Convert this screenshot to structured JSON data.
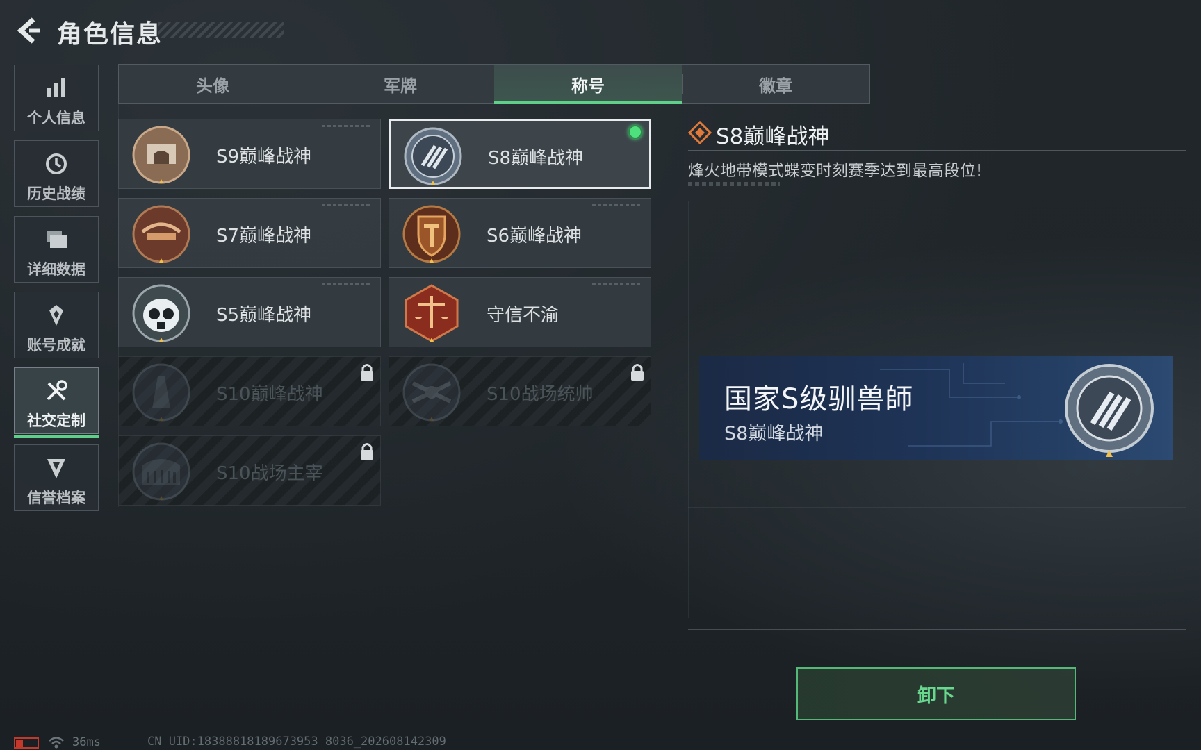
{
  "header": {
    "title": "角色信息"
  },
  "sidebar": {
    "items": [
      {
        "label": "个人信息",
        "icon": "bar-chart-icon",
        "active": false
      },
      {
        "label": "历史战绩",
        "icon": "history-clock-icon",
        "active": false
      },
      {
        "label": "详细数据",
        "icon": "folder-icon",
        "active": false
      },
      {
        "label": "账号成就",
        "icon": "achievement-icon",
        "active": false
      },
      {
        "label": "社交定制",
        "icon": "tools-icon",
        "active": true
      },
      {
        "label": "信誉档案",
        "icon": "reputation-icon",
        "active": false
      }
    ]
  },
  "tabs": [
    {
      "label": "头像",
      "active": false
    },
    {
      "label": "军牌",
      "active": false
    },
    {
      "label": "称号",
      "active": true
    },
    {
      "label": "徽章",
      "active": false
    }
  ],
  "titles": [
    {
      "name": "S9巅峰战神",
      "emblem": "arch-emblem-icon",
      "locked": false,
      "selected": false
    },
    {
      "name": "S8巅峰战神",
      "emblem": "s8-stripes-emblem-icon",
      "locked": false,
      "selected": true,
      "equipped": true
    },
    {
      "name": "S7巅峰战神",
      "emblem": "crossbow-emblem-icon",
      "locked": false,
      "selected": false
    },
    {
      "name": "S6巅峰战神",
      "emblem": "shield-t-emblem-icon",
      "locked": false,
      "selected": false
    },
    {
      "name": "S5巅峰战神",
      "emblem": "gasmask-skull-emblem-icon",
      "locked": false,
      "selected": false
    },
    {
      "name": "守信不渝",
      "emblem": "scales-emblem-icon",
      "locked": false,
      "selected": false
    },
    {
      "name": "S10巅峰战神",
      "emblem": "tower-emblem-icon",
      "locked": true,
      "selected": false
    },
    {
      "name": "S10战场统帅",
      "emblem": "drone-emblem-icon",
      "locked": true,
      "selected": false
    },
    {
      "name": "S10战场主宰",
      "emblem": "colosseum-emblem-icon",
      "locked": true,
      "selected": false
    }
  ],
  "detail": {
    "title": "S8巅峰战神",
    "description": "烽火地带模式蝶变时刻赛季达到最高段位!"
  },
  "preview": {
    "player_name": "国家S级驯兽師",
    "title": "S8巅峰战神"
  },
  "actions": {
    "unequip_label": "卸下"
  },
  "status": {
    "ping": "36ms",
    "uid": "CN UID:18388818189673953 8036_202608142309"
  },
  "colors": {
    "accent_green": "#5fd08a",
    "equipped_dot": "#4fe07e",
    "banner_blue": "#1e3356",
    "detail_orange": "#e07a3a"
  }
}
